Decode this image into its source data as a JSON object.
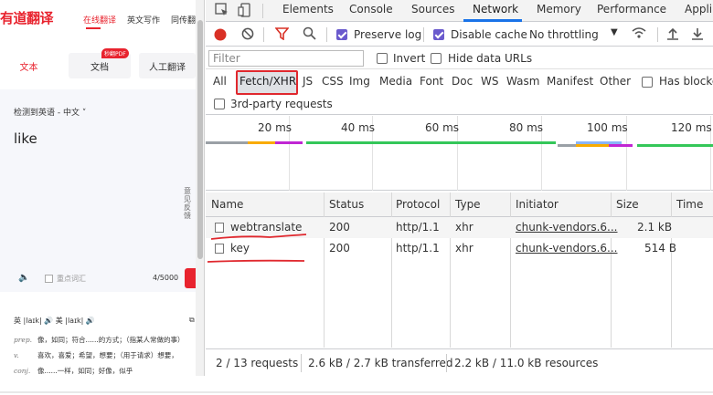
{
  "page": {
    "logo": "有道翻译",
    "nav": [
      "在线翻译",
      "英文写作",
      "同传翻"
    ],
    "subtabs": {
      "text": "文本",
      "doc": "文档",
      "human": "人工翻译"
    },
    "pdf_badge": "秒翻PDF",
    "lang_detect": "检测到英语 - 中文",
    "input_word": "like",
    "feedback": "意见反馈",
    "focus_label": "重点词汇",
    "char_count": "4/5000",
    "phonetic": "英 |laɪk|  🔊   美 |laɪk|  🔊",
    "definitions": [
      {
        "pos": "prep.",
        "text": "像，如同；符合......的方式；（指某人常做的事）"
      },
      {
        "pos": "v.",
        "text": "喜欢，喜爱；希望，想要；（用于请求）想要，"
      },
      {
        "pos": "conj.",
        "text": "像......一样，如同；好像，似乎"
      }
    ]
  },
  "devtools": {
    "tabs": [
      "Elements",
      "Console",
      "Sources",
      "Network",
      "Memory",
      "Performance",
      "Appli"
    ],
    "active_tab": "Network",
    "toolbar": {
      "preserve_log": "Preserve log",
      "disable_cache": "Disable cache",
      "throttling": "No throttling"
    },
    "filter": {
      "placeholder": "Filter",
      "invert": "Invert",
      "hide_data_urls": "Hide data URLs"
    },
    "types": [
      "All",
      "Fetch/XHR",
      "JS",
      "CSS",
      "Img",
      "Media",
      "Font",
      "Doc",
      "WS",
      "Wasm",
      "Manifest",
      "Other"
    ],
    "active_type": "Fetch/XHR",
    "has_blocked": "Has blocke",
    "third_party": "3rd-party requests",
    "timeline_ticks": [
      "20 ms",
      "40 ms",
      "60 ms",
      "80 ms",
      "100 ms",
      "120 ms"
    ],
    "columns": [
      "Name",
      "Status",
      "Protocol",
      "Type",
      "Initiator",
      "Size",
      "Time"
    ],
    "rows": [
      {
        "name": "webtranslate",
        "status": "200",
        "protocol": "http/1.1",
        "type": "xhr",
        "initiator": "chunk-vendors.6...",
        "size": "2.1 kB"
      },
      {
        "name": "key",
        "status": "200",
        "protocol": "http/1.1",
        "type": "xhr",
        "initiator": "chunk-vendors.6...",
        "size": "514 B"
      }
    ],
    "status": {
      "requests": "2 / 13 requests",
      "transferred": "2.6 kB / 2.7 kB transferred",
      "resources": "2.2 kB / 11.0 kB resources"
    },
    "colors": {
      "accent": "#1a73e8",
      "annotation": "#e0282e",
      "checkbox": "#6a5acd"
    }
  }
}
